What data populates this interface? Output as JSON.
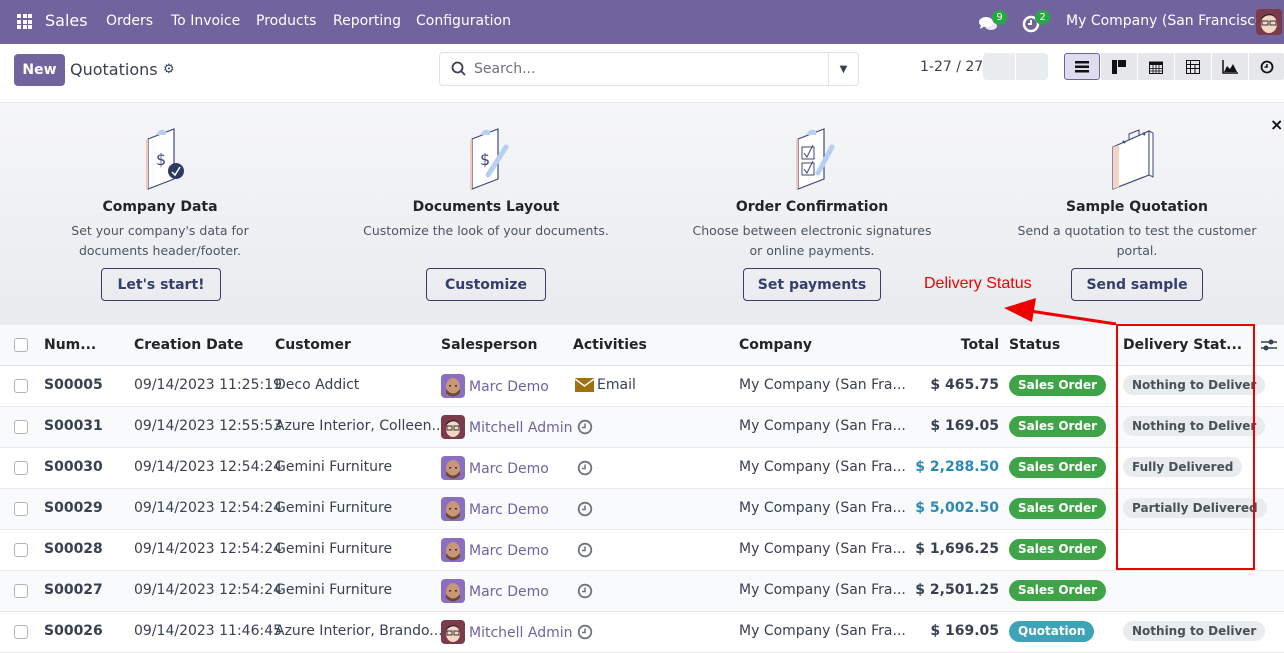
{
  "navbar": {
    "app_name": "Sales",
    "menu": [
      "Orders",
      "To Invoice",
      "Products",
      "Reporting",
      "Configuration"
    ],
    "messages_count": "9",
    "activities_count": "2",
    "company": "My Company (San Francisco)",
    "brand_color": "#71639e"
  },
  "control_panel": {
    "new_label": "New",
    "title": "Quotations",
    "search_placeholder": "Search...",
    "pager": "1-27 / 27",
    "views": [
      "list",
      "kanban",
      "calendar",
      "pivot",
      "graph",
      "activity"
    ],
    "active_view": "list"
  },
  "onboarding": {
    "steps": [
      {
        "title": "Company Data",
        "desc": "Set your company's data for documents header/footer.",
        "button": "Let's start!",
        "icon": "clipboard-check-icon"
      },
      {
        "title": "Documents Layout",
        "desc": "Customize the look of your documents.",
        "button": "Customize",
        "icon": "clipboard-pen-icon"
      },
      {
        "title": "Order Confirmation",
        "desc": "Choose between electronic signatures or online payments.",
        "button": "Set payments",
        "icon": "clipboard-checklist-icon"
      },
      {
        "title": "Sample Quotation",
        "desc": "Send a quotation to test the customer portal.",
        "button": "Send sample",
        "icon": "briefcase-icon"
      }
    ],
    "close_label": "×"
  },
  "annotation": {
    "label": "Delivery Status",
    "color": "#ee0000"
  },
  "table": {
    "headers": [
      "Num...",
      "Creation Date",
      "Customer",
      "Salesperson",
      "Activities",
      "Company",
      "Total",
      "Status",
      "Delivery Stat..."
    ],
    "rows": [
      {
        "number": "S00005",
        "date": "09/14/2023 11:25:19",
        "customer": "Deco Addict",
        "salesperson": "Marc Demo",
        "activity": "Email",
        "company": "My Company (San Fra...",
        "total": "$ 465.75",
        "total_highlight": false,
        "status": "Sales Order",
        "delivery": "Nothing to Deliver"
      },
      {
        "number": "S00031",
        "date": "09/14/2023 12:55:53",
        "customer": "Azure Interior, Colleen...",
        "salesperson": "Mitchell Admin",
        "activity": "",
        "company": "My Company (San Fra...",
        "total": "$ 169.05",
        "total_highlight": false,
        "status": "Sales Order",
        "delivery": "Nothing to Deliver"
      },
      {
        "number": "S00030",
        "date": "09/14/2023 12:54:24",
        "customer": "Gemini Furniture",
        "salesperson": "Marc Demo",
        "activity": "",
        "company": "My Company (San Fra...",
        "total": "$ 2,288.50",
        "total_highlight": true,
        "status": "Sales Order",
        "delivery": "Fully Delivered"
      },
      {
        "number": "S00029",
        "date": "09/14/2023 12:54:24",
        "customer": "Gemini Furniture",
        "salesperson": "Marc Demo",
        "activity": "",
        "company": "My Company (San Fra...",
        "total": "$ 5,002.50",
        "total_highlight": true,
        "status": "Sales Order",
        "delivery": "Partially Delivered"
      },
      {
        "number": "S00028",
        "date": "09/14/2023 12:54:24",
        "customer": "Gemini Furniture",
        "salesperson": "Marc Demo",
        "activity": "",
        "company": "My Company (San Fra...",
        "total": "$ 1,696.25",
        "total_highlight": false,
        "status": "Sales Order",
        "delivery": ""
      },
      {
        "number": "S00027",
        "date": "09/14/2023 12:54:24",
        "customer": "Gemini Furniture",
        "salesperson": "Marc Demo",
        "activity": "",
        "company": "My Company (San Fra...",
        "total": "$ 2,501.25",
        "total_highlight": false,
        "status": "Sales Order",
        "delivery": ""
      },
      {
        "number": "S00026",
        "date": "09/14/2023 11:46:45",
        "customer": "Azure Interior, Brando...",
        "salesperson": "Mitchell Admin",
        "activity": "",
        "company": "My Company (San Fra...",
        "total": "$ 169.05",
        "total_highlight": false,
        "status": "Quotation",
        "delivery": "Nothing to Deliver"
      }
    ],
    "status_colors": {
      "Sales Order": "#3fa447",
      "Quotation": "#3fa3b8"
    },
    "highlight_total_color": "#2b8ab5"
  }
}
